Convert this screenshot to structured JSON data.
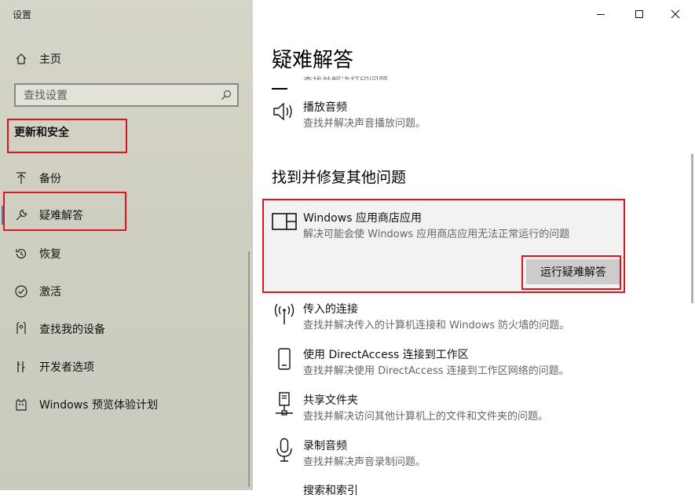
{
  "window": {
    "app_title": "设置"
  },
  "sidebar": {
    "home_label": "主页",
    "search_placeholder": "查找设置",
    "section_title": "更新和安全",
    "items": [
      {
        "label": "备份",
        "icon": "backup-arrow-icon"
      },
      {
        "label": "疑难解答",
        "icon": "wrench-icon",
        "selected": true
      },
      {
        "label": "恢复",
        "icon": "recovery-icon"
      },
      {
        "label": "激活",
        "icon": "activation-check-icon"
      },
      {
        "label": "查找我的设备",
        "icon": "find-device-icon"
      },
      {
        "label": "开发者选项",
        "icon": "developer-tools-icon"
      },
      {
        "label": "Windows 预览体验计划",
        "icon": "insider-cat-icon"
      }
    ]
  },
  "main": {
    "title": "疑难解答",
    "cut_desc": "查找并解决打印问题。",
    "top_items": [
      {
        "title": "播放音频",
        "desc": "查找并解决声音播放问题。",
        "icon": "speaker-icon"
      }
    ],
    "other_section_title": "找到并修复其他问题",
    "card": {
      "title": "Windows 应用商店应用",
      "desc": "解决可能会使 Windows 应用商店应用无法正常运行的问题",
      "button": "运行疑难解答",
      "icon": "store-app-icon"
    },
    "items": [
      {
        "title": "传入的连接",
        "desc": "查找并解决传入的计算机连接和 Windows 防火墙的问题。",
        "icon": "antenna-icon"
      },
      {
        "title": "使用 DirectAccess 连接到工作区",
        "desc": "查找并解决使用 DirectAccess 连接到工作区网络的问题。",
        "icon": "phone-device-icon"
      },
      {
        "title": "共享文件夹",
        "desc": "查找并解决访问其他计算机上的文件和文件夹的问题。",
        "icon": "network-share-icon"
      },
      {
        "title": "录制音频",
        "desc": "查找并解决声音录制问题。",
        "icon": "microphone-icon"
      }
    ],
    "bottom_cut": "搜索和索引"
  },
  "colors": {
    "highlight": "#e0141e",
    "accent": "#4a7ab0",
    "sidebar_bg": "#cfcfc1",
    "card_bg": "#f2f2f2"
  }
}
